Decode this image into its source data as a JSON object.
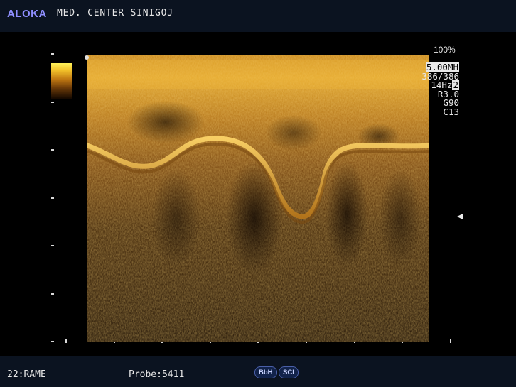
{
  "header": {
    "brand": "ALOKA",
    "center_name": "MED. CENTER SINIGOJ"
  },
  "colors": {
    "brand": "#8f8fff",
    "ultrasound_highlight": "#f2c12a",
    "ultrasound_shadow": "#2a1606"
  },
  "readout": {
    "power": "100%",
    "frequency": "5.00MH",
    "frame": "386/386",
    "frame_rate": "14Hz",
    "frame_rate_marker": "2",
    "range": "R3.0",
    "gain": "G90",
    "contrast": "C13"
  },
  "footer": {
    "preset": "22:RAME",
    "probe": "Probe:5411",
    "badges": [
      "BbH",
      "SCI"
    ]
  },
  "icons": {
    "focus_marker": "triangle-left-icon",
    "scale_bar": "grayscale-gradient",
    "depth_marker": "dot-icon"
  }
}
